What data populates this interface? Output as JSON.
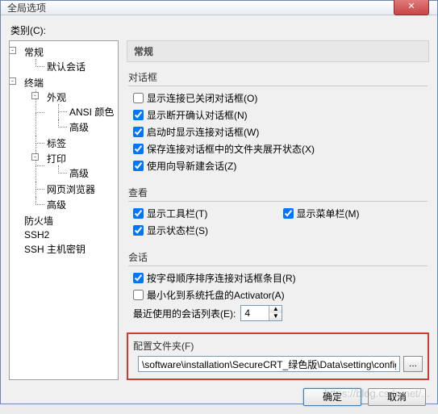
{
  "window": {
    "title": "全局选项",
    "close": "✕"
  },
  "category_label": "类别(C):",
  "tree": {
    "general": "常规",
    "default_session": "默认会话",
    "terminal": "终端",
    "appearance": "外观",
    "ansi_color": "ANSI 颜色",
    "advanced1": "高级",
    "tabs": "标签",
    "printing": "打印",
    "advanced2": "高级",
    "web_browser": "网页浏览器",
    "advanced3": "高级",
    "firewall": "防火墙",
    "ssh2": "SSH2",
    "ssh_hostkeys": "SSH 主机密钥"
  },
  "header": "常规",
  "groups": {
    "dialogs": {
      "title": "对话框",
      "show_closed": {
        "label": "显示连接已关闭对话框(O)",
        "checked": false
      },
      "show_disconnect_confirm": {
        "label": "显示断开确认对话框(N)",
        "checked": true
      },
      "show_connect_startup": {
        "label": "启动时显示连接对话框(W)",
        "checked": true
      },
      "save_expand_state": {
        "label": "保存连接对话框中的文件夹展开状态(X)",
        "checked": true
      },
      "use_wizard": {
        "label": "使用向导新建会话(Z)",
        "checked": true
      }
    },
    "view": {
      "title": "查看",
      "show_toolbar": {
        "label": "显示工具栏(T)",
        "checked": true
      },
      "show_menubar": {
        "label": "显示菜单栏(M)",
        "checked": true
      },
      "show_statusbar": {
        "label": "显示状态栏(S)",
        "checked": true
      }
    },
    "session": {
      "title": "会话",
      "sort_alpha": {
        "label": "按字母顺序排序连接对话框条目(R)",
        "checked": true
      },
      "minimize_tray": {
        "label": "最小化到系统托盘的Activator(A)",
        "checked": false
      },
      "recent_label": "最近使用的会话列表(E):",
      "recent_value": "4"
    },
    "config": {
      "title": "配置文件夹(F)",
      "path": "\\software\\installation\\SecureCRT_绿色版\\Data\\setting\\config",
      "browse": "..."
    }
  },
  "buttons": {
    "ok": "确定",
    "cancel": "取消"
  },
  "watermark": "https://blog.csdn.net/..."
}
